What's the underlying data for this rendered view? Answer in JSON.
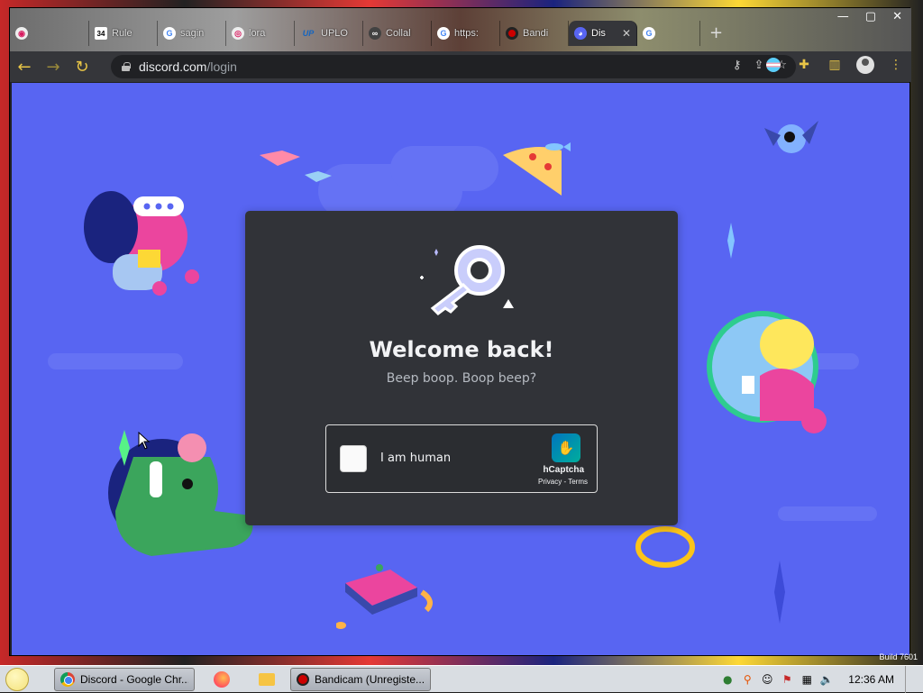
{
  "window_controls": {
    "minimize": "—",
    "maximize": "▢",
    "close": "✕"
  },
  "tabs": [
    {
      "label": "",
      "icon": "cam-icon"
    },
    {
      "label": "Rule",
      "icon": "grid-icon",
      "fav_text": "34"
    },
    {
      "label": "sagin",
      "icon": "google-icon",
      "fav_text": "G"
    },
    {
      "label": "lora",
      "icon": "camera-icon"
    },
    {
      "label": "UPLO",
      "icon": "upload-icon",
      "fav_text": "UP"
    },
    {
      "label": "Collal",
      "icon": "colab-icon"
    },
    {
      "label": "https:",
      "icon": "google-icon",
      "fav_text": "G"
    },
    {
      "label": "Bandi",
      "icon": "record-icon"
    },
    {
      "label": "Dis",
      "icon": "discord-icon",
      "active": true
    },
    {
      "label": "",
      "icon": "google-icon",
      "fav_text": "G"
    }
  ],
  "new_tab": "+",
  "address_bar": {
    "host": "discord.com",
    "path": "/login"
  },
  "login": {
    "title": "Welcome back!",
    "subtitle": "Beep boop. Boop beep?"
  },
  "captcha": {
    "label": "I am human",
    "brand": "hCaptcha",
    "privacy": "Privacy",
    "separator": " - ",
    "terms": "Terms"
  },
  "taskbar": {
    "items": [
      {
        "label": "Discord - Google Chr...",
        "icon": "chrome-icon"
      },
      {
        "label": "",
        "icon": "firefox-icon"
      },
      {
        "label": "",
        "icon": "folder-icon"
      },
      {
        "label": "Bandicam (Unregiste...",
        "icon": "bandicam-icon"
      }
    ],
    "clock": "12:36 AM",
    "build": "Build 7601"
  },
  "colors": {
    "blurple": "#5865f2",
    "modal": "#313338",
    "heading": "#f2f3f5",
    "subtext": "#b5bac1"
  }
}
